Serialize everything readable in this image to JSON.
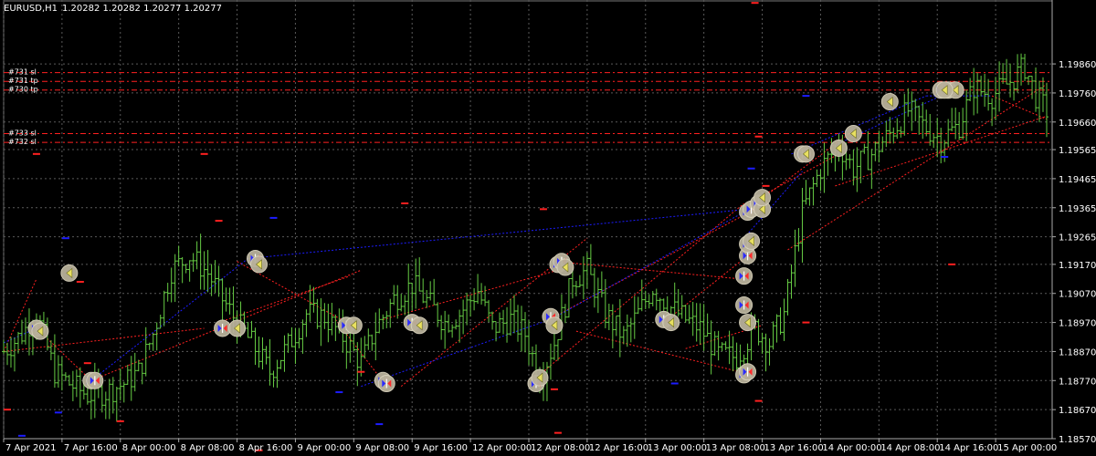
{
  "header": {
    "symbol": "EURUSD,H1",
    "ohlc": "1.20282 1.20282 1.20277 1.20277"
  },
  "colors": {
    "background": "#000000",
    "grid": "#5a5a5a",
    "candle": "#66cc44",
    "buy_line": "#1c1cff",
    "sell_line": "#ff2020",
    "level_line": "#ff2020",
    "marker_fill": "#b8b09a",
    "text": "#ffffff"
  },
  "chart_data": {
    "type": "candlestick",
    "symbol": "EURUSD",
    "timeframe": "H1",
    "ylim": [
      1.1857,
      1.2008
    ],
    "y_ticks": [
      "1.19860",
      "1.19760",
      "1.19660",
      "1.19565",
      "1.19465",
      "1.19365",
      "1.19265",
      "1.19170",
      "1.19070",
      "1.18970",
      "1.18870",
      "1.18770",
      "1.18670",
      "1.18570"
    ],
    "x_ticks": [
      "7 Apr 2021",
      "7 Apr 16:00",
      "8 Apr 00:00",
      "8 Apr 08:00",
      "8 Apr 16:00",
      "9 Apr 00:00",
      "9 Apr 08:00",
      "9 Apr 16:00",
      "12 Apr 00:00",
      "12 Apr 08:00",
      "12 Apr 16:00",
      "13 Apr 00:00",
      "13 Apr 08:00",
      "13 Apr 16:00",
      "14 Apr 00:00",
      "14 Apr 08:00",
      "14 Apr 16:00",
      "15 Apr 00:00"
    ],
    "level_labels": [
      {
        "text": "#731 sl",
        "price": 1.1983
      },
      {
        "text": "#731 tp",
        "price": 1.198
      },
      {
        "text": "#730 tp",
        "price": 1.1977
      },
      {
        "text": "#733 sl",
        "price": 1.1962
      },
      {
        "text": "#732 sl",
        "price": 1.1959
      }
    ],
    "close_path": [
      {
        "t": 0,
        "p": 1.1887
      },
      {
        "t": 5,
        "p": 1.1893
      },
      {
        "t": 9,
        "p": 1.19
      },
      {
        "t": 14,
        "p": 1.188
      },
      {
        "t": 18,
        "p": 1.1876
      },
      {
        "t": 23,
        "p": 1.1872
      },
      {
        "t": 28,
        "p": 1.1873
      },
      {
        "t": 33,
        "p": 1.1876
      },
      {
        "t": 37,
        "p": 1.188
      },
      {
        "t": 41,
        "p": 1.1893
      },
      {
        "t": 46,
        "p": 1.1915
      },
      {
        "t": 51,
        "p": 1.192
      },
      {
        "t": 56,
        "p": 1.1914
      },
      {
        "t": 60,
        "p": 1.1905
      },
      {
        "t": 64,
        "p": 1.1897
      },
      {
        "t": 69,
        "p": 1.1888
      },
      {
        "t": 73,
        "p": 1.188
      },
      {
        "t": 78,
        "p": 1.1889
      },
      {
        "t": 83,
        "p": 1.19
      },
      {
        "t": 88,
        "p": 1.1899
      },
      {
        "t": 93,
        "p": 1.1892
      },
      {
        "t": 98,
        "p": 1.1883
      },
      {
        "t": 102,
        "p": 1.1895
      },
      {
        "t": 107,
        "p": 1.1905
      },
      {
        "t": 112,
        "p": 1.191
      },
      {
        "t": 117,
        "p": 1.1903
      },
      {
        "t": 121,
        "p": 1.1897
      },
      {
        "t": 125,
        "p": 1.19
      },
      {
        "t": 130,
        "p": 1.1908
      },
      {
        "t": 134,
        "p": 1.1895
      },
      {
        "t": 139,
        "p": 1.1898
      },
      {
        "t": 143,
        "p": 1.1893
      },
      {
        "t": 147,
        "p": 1.1878
      },
      {
        "t": 151,
        "p": 1.189
      },
      {
        "t": 156,
        "p": 1.1912
      },
      {
        "t": 160,
        "p": 1.1915
      },
      {
        "t": 165,
        "p": 1.19
      },
      {
        "t": 170,
        "p": 1.1892
      },
      {
        "t": 174,
        "p": 1.19
      },
      {
        "t": 178,
        "p": 1.1909
      },
      {
        "t": 183,
        "p": 1.1902
      },
      {
        "t": 187,
        "p": 1.1898
      },
      {
        "t": 191,
        "p": 1.1895
      },
      {
        "t": 196,
        "p": 1.1886
      },
      {
        "t": 201,
        "p": 1.1885
      },
      {
        "t": 206,
        "p": 1.1895
      },
      {
        "t": 210,
        "p": 1.189
      },
      {
        "t": 214,
        "p": 1.19
      },
      {
        "t": 219,
        "p": 1.1935
      },
      {
        "t": 224,
        "p": 1.195
      },
      {
        "t": 229,
        "p": 1.1958
      },
      {
        "t": 233,
        "p": 1.195
      },
      {
        "t": 238,
        "p": 1.1955
      },
      {
        "t": 243,
        "p": 1.1962
      },
      {
        "t": 248,
        "p": 1.197
      },
      {
        "t": 252,
        "p": 1.1965
      },
      {
        "t": 257,
        "p": 1.196
      },
      {
        "t": 262,
        "p": 1.1965
      },
      {
        "t": 266,
        "p": 1.1978
      },
      {
        "t": 271,
        "p": 1.1975
      },
      {
        "t": 276,
        "p": 1.198
      },
      {
        "t": 280,
        "p": 1.1985
      },
      {
        "t": 283,
        "p": 1.1975
      },
      {
        "t": 286,
        "p": 1.197
      }
    ],
    "level_lines": [
      {
        "price": 1.1983
      },
      {
        "price": 1.198
      },
      {
        "price": 1.1977
      },
      {
        "price": 1.1962
      },
      {
        "price": 1.1959
      }
    ],
    "trade_lines": [
      {
        "side": "sell",
        "from": [
          0,
          1.1887
        ],
        "to": [
          9,
          1.1912
        ]
      },
      {
        "side": "sell",
        "from": [
          0,
          1.1887
        ],
        "to": [
          55,
          1.1895
        ]
      },
      {
        "side": "sell",
        "from": [
          9,
          1.1895
        ],
        "to": [
          24,
          1.1877
        ]
      },
      {
        "side": "sell",
        "from": [
          24,
          1.1877
        ],
        "to": [
          98,
          1.1915
        ]
      },
      {
        "side": "sell",
        "from": [
          59,
          1.1897
        ],
        "to": [
          95,
          1.1913
        ]
      },
      {
        "side": "sell",
        "from": [
          64,
          1.1918
        ],
        "to": [
          94,
          1.1897
        ]
      },
      {
        "side": "sell",
        "from": [
          91,
          1.1898
        ],
        "to": [
          105,
          1.1875
        ]
      },
      {
        "side": "sell",
        "from": [
          104,
          1.1898
        ],
        "to": [
          152,
          1.1915
        ]
      },
      {
        "side": "sell",
        "from": [
          109,
          1.1875
        ],
        "to": [
          160,
          1.1926
        ]
      },
      {
        "side": "sell",
        "from": [
          146,
          1.1878
        ],
        "to": [
          203,
          1.1938
        ]
      },
      {
        "side": "sell",
        "from": [
          151,
          1.1899
        ],
        "to": [
          209,
          1.1938
        ]
      },
      {
        "side": "sell",
        "from": [
          151,
          1.1918
        ],
        "to": [
          202,
          1.1912
        ]
      },
      {
        "side": "sell",
        "from": [
          157,
          1.1894
        ],
        "to": [
          205,
          1.1879
        ]
      },
      {
        "side": "sell",
        "from": [
          181,
          1.1897
        ],
        "to": [
          206,
          1.1922
        ]
      },
      {
        "side": "sell",
        "from": [
          187,
          1.1888
        ],
        "to": [
          208,
          1.1896
        ]
      },
      {
        "side": "sell",
        "from": [
          204,
          1.1936
        ],
        "to": [
          233,
          1.1963
        ]
      },
      {
        "side": "sell",
        "from": [
          207,
          1.194
        ],
        "to": [
          229,
          1.1955
        ]
      },
      {
        "side": "sell",
        "from": [
          215,
          1.1922
        ],
        "to": [
          286,
          1.1979
        ]
      },
      {
        "side": "sell",
        "from": [
          228,
          1.1944
        ],
        "to": [
          286,
          1.1968
        ]
      },
      {
        "side": "sell",
        "from": [
          271,
          1.1975
        ],
        "to": [
          286,
          1.1967
        ]
      },
      {
        "side": "buy",
        "from": [
          0,
          1.189
        ],
        "to": [
          9,
          1.1895
        ]
      },
      {
        "side": "buy",
        "from": [
          24,
          1.1877
        ],
        "to": [
          67,
          1.1919
        ]
      },
      {
        "side": "buy",
        "from": [
          67,
          1.1919
        ],
        "to": [
          204,
          1.1936
        ]
      },
      {
        "side": "buy",
        "from": [
          98,
          1.1875
        ],
        "to": [
          152,
          1.1899
        ]
      },
      {
        "side": "buy",
        "from": [
          150,
          1.1898
        ],
        "to": [
          203,
          1.1935
        ]
      },
      {
        "side": "buy",
        "from": [
          203,
          1.1926
        ],
        "to": [
          219,
          1.1949
        ]
      },
      {
        "side": "buy",
        "from": [
          216,
          1.1955
        ],
        "to": [
          253,
          1.1975
        ]
      },
      {
        "side": "buy",
        "from": [
          228,
          1.1958
        ],
        "to": [
          257,
          1.1975
        ]
      },
      {
        "side": "buy",
        "from": [
          253,
          1.1975
        ],
        "to": [
          271,
          1.1975
        ]
      }
    ],
    "trade_markers": [
      {
        "t": 9,
        "p": 1.1895,
        "k": "buy"
      },
      {
        "t": 10,
        "p": 1.1894,
        "k": "close"
      },
      {
        "t": 18,
        "p": 1.1914,
        "k": "close"
      },
      {
        "t": 24,
        "p": 1.1877,
        "k": "buy"
      },
      {
        "t": 25,
        "p": 1.1877,
        "k": "buy"
      },
      {
        "t": 60,
        "p": 1.1895,
        "k": "buy"
      },
      {
        "t": 64,
        "p": 1.1895,
        "k": "close"
      },
      {
        "t": 69,
        "p": 1.1919,
        "k": "buy"
      },
      {
        "t": 70,
        "p": 1.1917,
        "k": "close"
      },
      {
        "t": 94,
        "p": 1.1896,
        "k": "buy"
      },
      {
        "t": 96,
        "p": 1.1896,
        "k": "close"
      },
      {
        "t": 104,
        "p": 1.1877,
        "k": "buy"
      },
      {
        "t": 105,
        "p": 1.1876,
        "k": "buy"
      },
      {
        "t": 112,
        "p": 1.1897,
        "k": "buy"
      },
      {
        "t": 114,
        "p": 1.1896,
        "k": "close"
      },
      {
        "t": 146,
        "p": 1.1876,
        "k": "buy"
      },
      {
        "t": 147,
        "p": 1.1878,
        "k": "close"
      },
      {
        "t": 150,
        "p": 1.1899,
        "k": "buy"
      },
      {
        "t": 151,
        "p": 1.1896,
        "k": "close"
      },
      {
        "t": 152,
        "p": 1.1917,
        "k": "buy"
      },
      {
        "t": 153,
        "p": 1.1918,
        "k": "buy"
      },
      {
        "t": 154,
        "p": 1.1916,
        "k": "close"
      },
      {
        "t": 181,
        "p": 1.1898,
        "k": "buy"
      },
      {
        "t": 183,
        "p": 1.1897,
        "k": "close"
      },
      {
        "t": 203,
        "p": 1.1879,
        "k": "buy"
      },
      {
        "t": 204,
        "p": 1.188,
        "k": "buy"
      },
      {
        "t": 203,
        "p": 1.1903,
        "k": "buy"
      },
      {
        "t": 204,
        "p": 1.1897,
        "k": "close"
      },
      {
        "t": 203,
        "p": 1.1913,
        "k": "buy"
      },
      {
        "t": 204,
        "p": 1.192,
        "k": "buy"
      },
      {
        "t": 204,
        "p": 1.1924,
        "k": "buy"
      },
      {
        "t": 205,
        "p": 1.1925,
        "k": "close"
      },
      {
        "t": 204,
        "p": 1.1935,
        "k": "buy"
      },
      {
        "t": 205,
        "p": 1.1936,
        "k": "buy"
      },
      {
        "t": 207,
        "p": 1.1938,
        "k": "buy"
      },
      {
        "t": 208,
        "p": 1.1936,
        "k": "close"
      },
      {
        "t": 208,
        "p": 1.194,
        "k": "close"
      },
      {
        "t": 219,
        "p": 1.1955,
        "k": "buy"
      },
      {
        "t": 220,
        "p": 1.1955,
        "k": "close"
      },
      {
        "t": 229,
        "p": 1.1957,
        "k": "close"
      },
      {
        "t": 233,
        "p": 1.1962,
        "k": "close"
      },
      {
        "t": 243,
        "p": 1.1973,
        "k": "close"
      },
      {
        "t": 257,
        "p": 1.1977,
        "k": "buy"
      },
      {
        "t": 259,
        "p": 1.1977,
        "k": "buy"
      },
      {
        "t": 261,
        "p": 1.1977,
        "k": "close"
      },
      {
        "t": 258,
        "p": 1.1977,
        "k": "close"
      }
    ],
    "stop_marks": [
      {
        "t": 1,
        "p": 1.1867,
        "side": "sell"
      },
      {
        "t": 9,
        "p": 1.1955,
        "side": "sell"
      },
      {
        "t": 21,
        "p": 1.1911,
        "side": "sell"
      },
      {
        "t": 23,
        "p": 1.1883,
        "side": "sell"
      },
      {
        "t": 32,
        "p": 1.1863,
        "side": "sell"
      },
      {
        "t": 55,
        "p": 1.1955,
        "side": "sell"
      },
      {
        "t": 59,
        "p": 1.1932,
        "side": "sell"
      },
      {
        "t": 70,
        "p": 1.1853,
        "side": "sell"
      },
      {
        "t": 98,
        "p": 1.188,
        "side": "sell"
      },
      {
        "t": 110,
        "p": 1.1938,
        "side": "sell"
      },
      {
        "t": 148,
        "p": 1.1936,
        "side": "sell"
      },
      {
        "t": 152,
        "p": 1.1859,
        "side": "sell"
      },
      {
        "t": 151,
        "p": 1.1874,
        "side": "sell"
      },
      {
        "t": 206,
        "p": 1.2007,
        "side": "sell"
      },
      {
        "t": 207,
        "p": 1.1961,
        "side": "sell"
      },
      {
        "t": 207,
        "p": 1.187,
        "side": "sell"
      },
      {
        "t": 209,
        "p": 1.1944,
        "side": "sell"
      },
      {
        "t": 220,
        "p": 1.1897,
        "side": "sell"
      },
      {
        "t": 260,
        "p": 1.1917,
        "side": "sell"
      },
      {
        "t": 5,
        "p": 1.1858,
        "side": "buy"
      },
      {
        "t": 15,
        "p": 1.1866,
        "side": "buy"
      },
      {
        "t": 17,
        "p": 1.1926,
        "side": "buy"
      },
      {
        "t": 74,
        "p": 1.1933,
        "side": "buy"
      },
      {
        "t": 92,
        "p": 1.1873,
        "side": "buy"
      },
      {
        "t": 103,
        "p": 1.1862,
        "side": "buy"
      },
      {
        "t": 184,
        "p": 1.1876,
        "side": "buy"
      },
      {
        "t": 205,
        "p": 1.195,
        "side": "buy"
      },
      {
        "t": 220,
        "p": 1.1975,
        "side": "buy"
      },
      {
        "t": 258,
        "p": 1.1954,
        "side": "buy"
      }
    ]
  }
}
